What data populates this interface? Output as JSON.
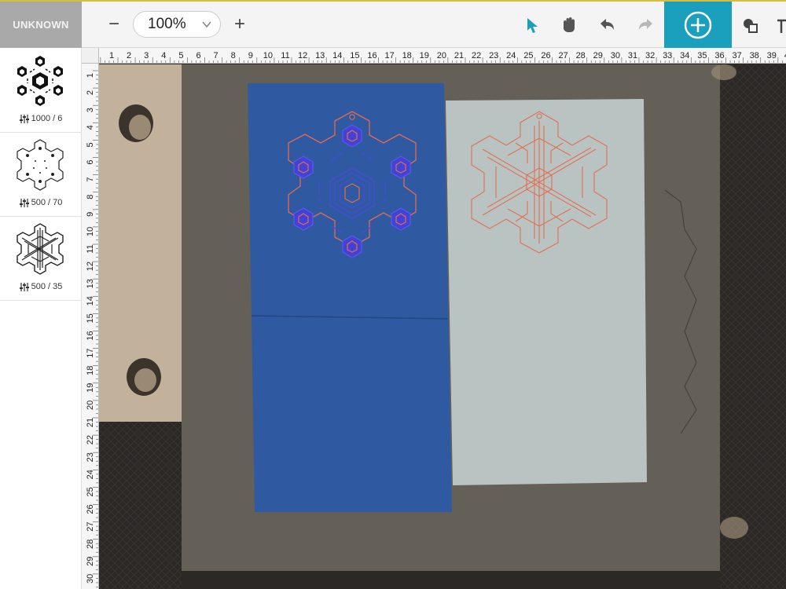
{
  "toolbar": {
    "machine_label": "UNKNOWN",
    "zoom_value": "100%",
    "zoom_out_label": "−",
    "zoom_in_label": "+",
    "tools": [
      {
        "name": "select-tool",
        "icon": "cursor-arrow-icon"
      },
      {
        "name": "pan-tool",
        "icon": "hand-icon"
      },
      {
        "name": "undo",
        "icon": "undo-icon"
      },
      {
        "name": "redo",
        "icon": "redo-icon"
      },
      {
        "name": "add",
        "icon": "plus-circle-icon"
      },
      {
        "name": "shapes",
        "icon": "shapes-icon"
      }
    ],
    "accent_color": "#1aa0bd",
    "active_tool_color": "#1a9ebb"
  },
  "sidebar": {
    "designs": [
      {
        "thumbnail": "snowflake-hexagon-icon",
        "settings": "1000 / 6"
      },
      {
        "thumbnail": "snowflake-dots-outline-icon",
        "settings": "500 / 70"
      },
      {
        "thumbnail": "snowflake-geometric-icon",
        "settings": "500 / 35"
      }
    ]
  },
  "rulers": {
    "top": [
      "1",
      "2",
      "3",
      "4",
      "5",
      "6",
      "7",
      "8",
      "9",
      "10",
      "11",
      "12",
      "13",
      "14",
      "15",
      "16",
      "17",
      "18",
      "19",
      "20",
      "21",
      "22",
      "23",
      "24",
      "25",
      "26",
      "27",
      "28",
      "29",
      "30",
      "31",
      "32",
      "33",
      "34",
      "35",
      "36",
      "37",
      "38",
      "39",
      "40"
    ],
    "left": [
      "1",
      "2",
      "3",
      "4",
      "5",
      "6",
      "7",
      "8",
      "9",
      "10",
      "11",
      "12",
      "13",
      "14",
      "15",
      "16",
      "17",
      "18",
      "19",
      "20",
      "21",
      "22",
      "23",
      "24",
      "25",
      "26",
      "27",
      "28",
      "29",
      "30"
    ]
  },
  "bed": {
    "materials": [
      {
        "name": "blue-paper",
        "color": "#2f5aa1"
      },
      {
        "name": "light-gray-paper",
        "color": "#b9c3c2"
      }
    ],
    "cut_line_color": "#e66a4e",
    "engrave_color": "#3b3ccf"
  }
}
